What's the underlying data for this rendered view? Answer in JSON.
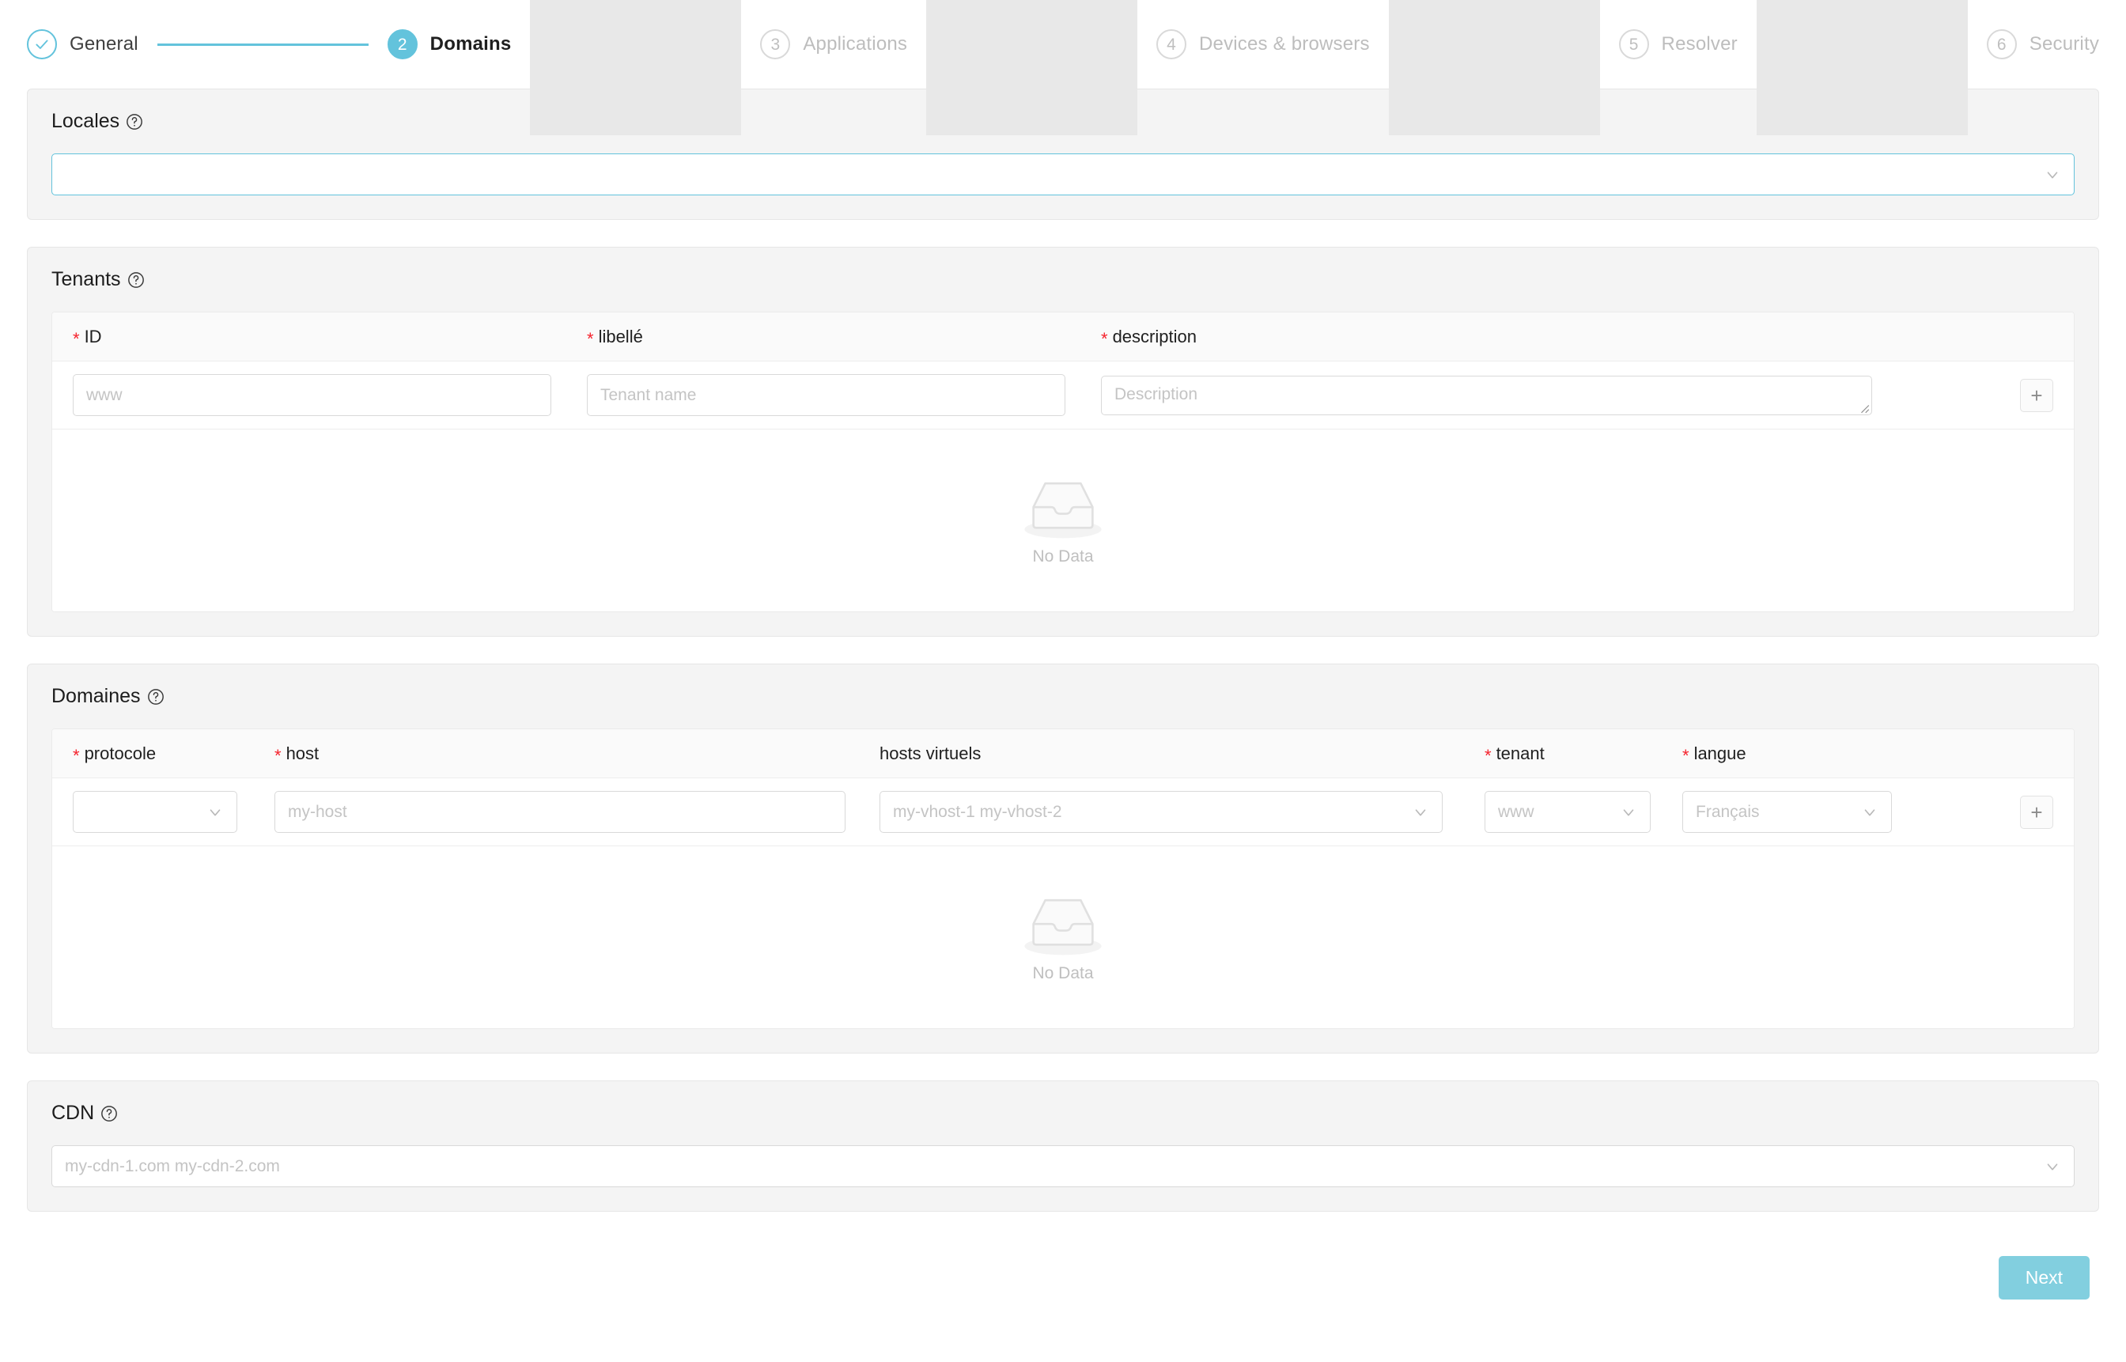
{
  "stepper": {
    "steps": [
      {
        "num": "1",
        "label": "General",
        "state": "done"
      },
      {
        "num": "2",
        "label": "Domains",
        "state": "active"
      },
      {
        "num": "3",
        "label": "Applications",
        "state": "todo"
      },
      {
        "num": "4",
        "label": "Devices & browsers",
        "state": "todo"
      },
      {
        "num": "5",
        "label": "Resolver",
        "state": "todo"
      },
      {
        "num": "6",
        "label": "Security",
        "state": "todo"
      }
    ]
  },
  "colors": {
    "accent": "#63c3dc",
    "next_button": "#82cfdf",
    "required_star": "#f5222d",
    "panel_bg": "#f4f4f4",
    "table_header_bg": "#fafafa"
  },
  "locales": {
    "title": "Locales",
    "help_icon": "question-circle-icon",
    "select": {
      "value": "",
      "placeholder": "",
      "chevron": "chevron-down-icon"
    }
  },
  "tenants": {
    "title": "Tenants",
    "help_icon": "question-circle-icon",
    "columns": [
      {
        "label": "ID",
        "required": true
      },
      {
        "label": "libellé",
        "required": true
      },
      {
        "label": "description",
        "required": true
      }
    ],
    "row": {
      "id_placeholder": "www",
      "libelle_placeholder": "Tenant name",
      "description_placeholder": "Description"
    },
    "add_button_label": "+",
    "empty": {
      "icon": "empty-inbox-icon",
      "text": "No Data"
    }
  },
  "domaines": {
    "title": "Domaines",
    "help_icon": "question-circle-icon",
    "columns": [
      {
        "label": "protocole",
        "required": true
      },
      {
        "label": "host",
        "required": true
      },
      {
        "label": "hosts virtuels",
        "required": false
      },
      {
        "label": "tenant",
        "required": true
      },
      {
        "label": "langue",
        "required": true
      }
    ],
    "row": {
      "protocole_value": "",
      "host_placeholder": "my-host",
      "vhosts_placeholder": "my-vhost-1 my-vhost-2",
      "tenant_placeholder": "www",
      "langue_placeholder": "Français"
    },
    "add_button_label": "+",
    "empty": {
      "icon": "empty-inbox-icon",
      "text": "No Data"
    }
  },
  "cdn": {
    "title": "CDN",
    "help_icon": "question-circle-icon",
    "select": {
      "placeholder": "my-cdn-1.com my-cdn-2.com",
      "chevron": "chevron-down-icon"
    }
  },
  "footer": {
    "next_label": "Next"
  }
}
